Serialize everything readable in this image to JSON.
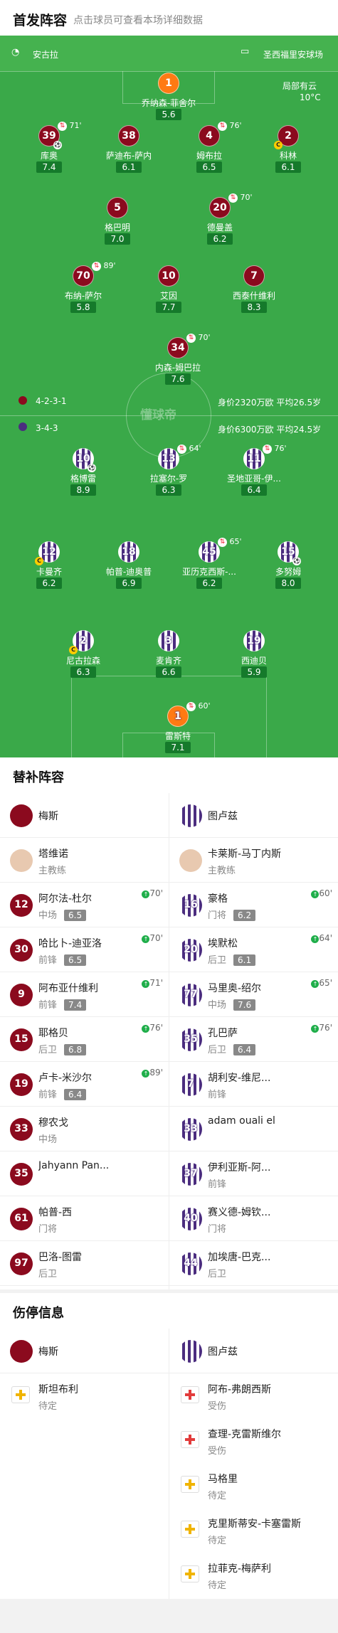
{
  "header": {
    "title": "首发阵容",
    "subtitle": "点击球员可查看本场详细数据"
  },
  "match": {
    "home_team": "安古拉",
    "away_team": "圣西福里安球场",
    "weather_label": "局部有云",
    "temperature": "10°C"
  },
  "home_formation": {
    "formation": "4-2-3-1",
    "info": "身价2320万欧 平均26.5岁"
  },
  "away_formation": {
    "formation": "3-4-3",
    "info": "身价6300万欧 平均24.5岁"
  },
  "watermark": "懂球帝",
  "home_players": [
    {
      "num": "1",
      "name": "乔纳森-菲舍尔",
      "rating": "5.6",
      "gk": true
    },
    {
      "num": "39",
      "name": "库奥",
      "rating": "7.4",
      "ev": "71'"
    },
    {
      "num": "38",
      "name": "萨迪布-萨内",
      "rating": "6.1"
    },
    {
      "num": "4",
      "name": "姆布拉",
      "rating": "6.5",
      "ev": "76'"
    },
    {
      "num": "2",
      "name": "科林",
      "rating": "6.1"
    },
    {
      "num": "5",
      "name": "格巴明",
      "rating": "7.0"
    },
    {
      "num": "20",
      "name": "德曼盖",
      "rating": "6.2",
      "ev": "70'"
    },
    {
      "num": "70",
      "name": "布纳-萨尔",
      "rating": "5.8",
      "ev": "89'"
    },
    {
      "num": "10",
      "name": "艾因",
      "rating": "7.7"
    },
    {
      "num": "7",
      "name": "西泰什维利",
      "rating": "8.3"
    },
    {
      "num": "34",
      "name": "内森-姆巴拉",
      "rating": "7.6",
      "ev": "70'"
    }
  ],
  "away_players": [
    {
      "num": "10",
      "name": "格博雷",
      "rating": "8.9"
    },
    {
      "num": "13",
      "name": "拉塞尔-罗",
      "rating": "6.3",
      "ev": "64'"
    },
    {
      "num": "11",
      "name": "圣地亚哥-伊...",
      "rating": "6.4",
      "ev": "76'"
    },
    {
      "num": "12",
      "name": "卡曼齐",
      "rating": "6.2"
    },
    {
      "num": "18",
      "name": "帕普-迪奥普",
      "rating": "6.9"
    },
    {
      "num": "45",
      "name": "亚历克西斯-...",
      "rating": "6.2",
      "ev": "65'"
    },
    {
      "num": "15",
      "name": "多努姆",
      "rating": "8.0"
    },
    {
      "num": "2",
      "name": "尼古拉森",
      "rating": "6.3"
    },
    {
      "num": "3",
      "name": "麦肯齐",
      "rating": "6.6"
    },
    {
      "num": "19",
      "name": "西迪贝",
      "rating": "5.9"
    },
    {
      "num": "1",
      "name": "雷斯特",
      "rating": "7.1",
      "gk": true,
      "ev": "60'"
    }
  ],
  "subs_section": {
    "title": "替补阵容",
    "home_team": "梅斯",
    "away_team": "图卢兹",
    "home_coach": {
      "name": "塔维诺",
      "role": "主教练"
    },
    "away_coach": {
      "name": "卡莱斯-马丁内斯",
      "role": "主教练"
    },
    "home": [
      {
        "num": "12",
        "name": "阿尔法-杜尔",
        "pos": "中场",
        "rating": "6.5",
        "ev": "70'"
      },
      {
        "num": "30",
        "name": "哈比卜-迪亚洛",
        "pos": "前锋",
        "rating": "6.5",
        "ev": "70'"
      },
      {
        "num": "9",
        "name": "阿布亚什维利",
        "pos": "前锋",
        "rating": "7.4",
        "ev": "71'"
      },
      {
        "num": "15",
        "name": "耶格贝",
        "pos": "后卫",
        "rating": "6.8",
        "ev": "76'"
      },
      {
        "num": "19",
        "name": "卢卡-米沙尔",
        "pos": "前锋",
        "rating": "6.4",
        "ev": "89'"
      },
      {
        "num": "33",
        "name": "穆农戈",
        "pos": "中场"
      },
      {
        "num": "35",
        "name": "Jahyann Pan...",
        "pos": ""
      },
      {
        "num": "61",
        "name": "帕普-西",
        "pos": "门将"
      },
      {
        "num": "97",
        "name": "巴洛-图雷",
        "pos": "后卫"
      }
    ],
    "away": [
      {
        "num": "16",
        "name": "豪格",
        "pos": "门将",
        "rating": "6.2",
        "ev": "60'"
      },
      {
        "num": "20",
        "name": "埃默松",
        "pos": "后卫",
        "rating": "6.1",
        "ev": "64'"
      },
      {
        "num": "77",
        "name": "马里奥-绍尔",
        "pos": "中场",
        "rating": "7.6",
        "ev": "65'"
      },
      {
        "num": "35",
        "name": "孔巴萨",
        "pos": "后卫",
        "rating": "6.4",
        "ev": "76'"
      },
      {
        "num": "7",
        "name": "胡利安-维尼...",
        "pos": "前锋"
      },
      {
        "num": "33",
        "name": "adam ouali el",
        "pos": ""
      },
      {
        "num": "37",
        "name": "伊利亚斯-阿...",
        "pos": "前锋"
      },
      {
        "num": "40",
        "name": "赛义德-姆钦...",
        "pos": "门将"
      },
      {
        "num": "44",
        "name": "加埃唐-巴克...",
        "pos": "后卫"
      }
    ]
  },
  "injury_section": {
    "title": "伤停信息",
    "home_team": "梅斯",
    "away_team": "图卢兹",
    "home": [
      {
        "name": "斯坦布利",
        "status": "待定",
        "color": "#f0b400"
      }
    ],
    "away": [
      {
        "name": "阿布-弗朗西斯",
        "status": "受伤",
        "color": "#e23b3b"
      },
      {
        "name": "查理-克雷斯维尔",
        "status": "受伤",
        "color": "#e23b3b"
      },
      {
        "name": "马格里",
        "status": "待定",
        "color": "#f0b400"
      },
      {
        "name": "克里斯蒂安-卡塞雷斯",
        "status": "待定",
        "color": "#f0b400"
      },
      {
        "name": "拉菲克-梅萨利",
        "status": "待定",
        "color": "#f0b400"
      }
    ]
  }
}
